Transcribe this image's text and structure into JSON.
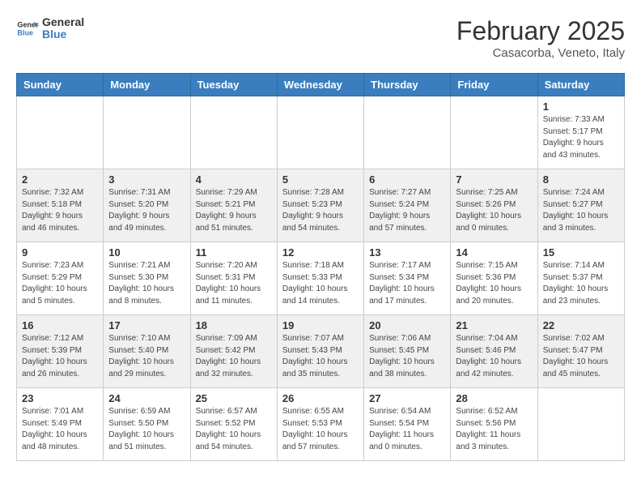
{
  "header": {
    "logo_general": "General",
    "logo_blue": "Blue",
    "month_year": "February 2025",
    "location": "Casacorba, Veneto, Italy"
  },
  "weekdays": [
    "Sunday",
    "Monday",
    "Tuesday",
    "Wednesday",
    "Thursday",
    "Friday",
    "Saturday"
  ],
  "weeks": [
    [
      {
        "day": "",
        "info": ""
      },
      {
        "day": "",
        "info": ""
      },
      {
        "day": "",
        "info": ""
      },
      {
        "day": "",
        "info": ""
      },
      {
        "day": "",
        "info": ""
      },
      {
        "day": "",
        "info": ""
      },
      {
        "day": "1",
        "info": "Sunrise: 7:33 AM\nSunset: 5:17 PM\nDaylight: 9 hours\nand 43 minutes."
      }
    ],
    [
      {
        "day": "2",
        "info": "Sunrise: 7:32 AM\nSunset: 5:18 PM\nDaylight: 9 hours\nand 46 minutes."
      },
      {
        "day": "3",
        "info": "Sunrise: 7:31 AM\nSunset: 5:20 PM\nDaylight: 9 hours\nand 49 minutes."
      },
      {
        "day": "4",
        "info": "Sunrise: 7:29 AM\nSunset: 5:21 PM\nDaylight: 9 hours\nand 51 minutes."
      },
      {
        "day": "5",
        "info": "Sunrise: 7:28 AM\nSunset: 5:23 PM\nDaylight: 9 hours\nand 54 minutes."
      },
      {
        "day": "6",
        "info": "Sunrise: 7:27 AM\nSunset: 5:24 PM\nDaylight: 9 hours\nand 57 minutes."
      },
      {
        "day": "7",
        "info": "Sunrise: 7:25 AM\nSunset: 5:26 PM\nDaylight: 10 hours\nand 0 minutes."
      },
      {
        "day": "8",
        "info": "Sunrise: 7:24 AM\nSunset: 5:27 PM\nDaylight: 10 hours\nand 3 minutes."
      }
    ],
    [
      {
        "day": "9",
        "info": "Sunrise: 7:23 AM\nSunset: 5:29 PM\nDaylight: 10 hours\nand 5 minutes."
      },
      {
        "day": "10",
        "info": "Sunrise: 7:21 AM\nSunset: 5:30 PM\nDaylight: 10 hours\nand 8 minutes."
      },
      {
        "day": "11",
        "info": "Sunrise: 7:20 AM\nSunset: 5:31 PM\nDaylight: 10 hours\nand 11 minutes."
      },
      {
        "day": "12",
        "info": "Sunrise: 7:18 AM\nSunset: 5:33 PM\nDaylight: 10 hours\nand 14 minutes."
      },
      {
        "day": "13",
        "info": "Sunrise: 7:17 AM\nSunset: 5:34 PM\nDaylight: 10 hours\nand 17 minutes."
      },
      {
        "day": "14",
        "info": "Sunrise: 7:15 AM\nSunset: 5:36 PM\nDaylight: 10 hours\nand 20 minutes."
      },
      {
        "day": "15",
        "info": "Sunrise: 7:14 AM\nSunset: 5:37 PM\nDaylight: 10 hours\nand 23 minutes."
      }
    ],
    [
      {
        "day": "16",
        "info": "Sunrise: 7:12 AM\nSunset: 5:39 PM\nDaylight: 10 hours\nand 26 minutes."
      },
      {
        "day": "17",
        "info": "Sunrise: 7:10 AM\nSunset: 5:40 PM\nDaylight: 10 hours\nand 29 minutes."
      },
      {
        "day": "18",
        "info": "Sunrise: 7:09 AM\nSunset: 5:42 PM\nDaylight: 10 hours\nand 32 minutes."
      },
      {
        "day": "19",
        "info": "Sunrise: 7:07 AM\nSunset: 5:43 PM\nDaylight: 10 hours\nand 35 minutes."
      },
      {
        "day": "20",
        "info": "Sunrise: 7:06 AM\nSunset: 5:45 PM\nDaylight: 10 hours\nand 38 minutes."
      },
      {
        "day": "21",
        "info": "Sunrise: 7:04 AM\nSunset: 5:46 PM\nDaylight: 10 hours\nand 42 minutes."
      },
      {
        "day": "22",
        "info": "Sunrise: 7:02 AM\nSunset: 5:47 PM\nDaylight: 10 hours\nand 45 minutes."
      }
    ],
    [
      {
        "day": "23",
        "info": "Sunrise: 7:01 AM\nSunset: 5:49 PM\nDaylight: 10 hours\nand 48 minutes."
      },
      {
        "day": "24",
        "info": "Sunrise: 6:59 AM\nSunset: 5:50 PM\nDaylight: 10 hours\nand 51 minutes."
      },
      {
        "day": "25",
        "info": "Sunrise: 6:57 AM\nSunset: 5:52 PM\nDaylight: 10 hours\nand 54 minutes."
      },
      {
        "day": "26",
        "info": "Sunrise: 6:55 AM\nSunset: 5:53 PM\nDaylight: 10 hours\nand 57 minutes."
      },
      {
        "day": "27",
        "info": "Sunrise: 6:54 AM\nSunset: 5:54 PM\nDaylight: 11 hours\nand 0 minutes."
      },
      {
        "day": "28",
        "info": "Sunrise: 6:52 AM\nSunset: 5:56 PM\nDaylight: 11 hours\nand 3 minutes."
      },
      {
        "day": "",
        "info": ""
      }
    ]
  ]
}
